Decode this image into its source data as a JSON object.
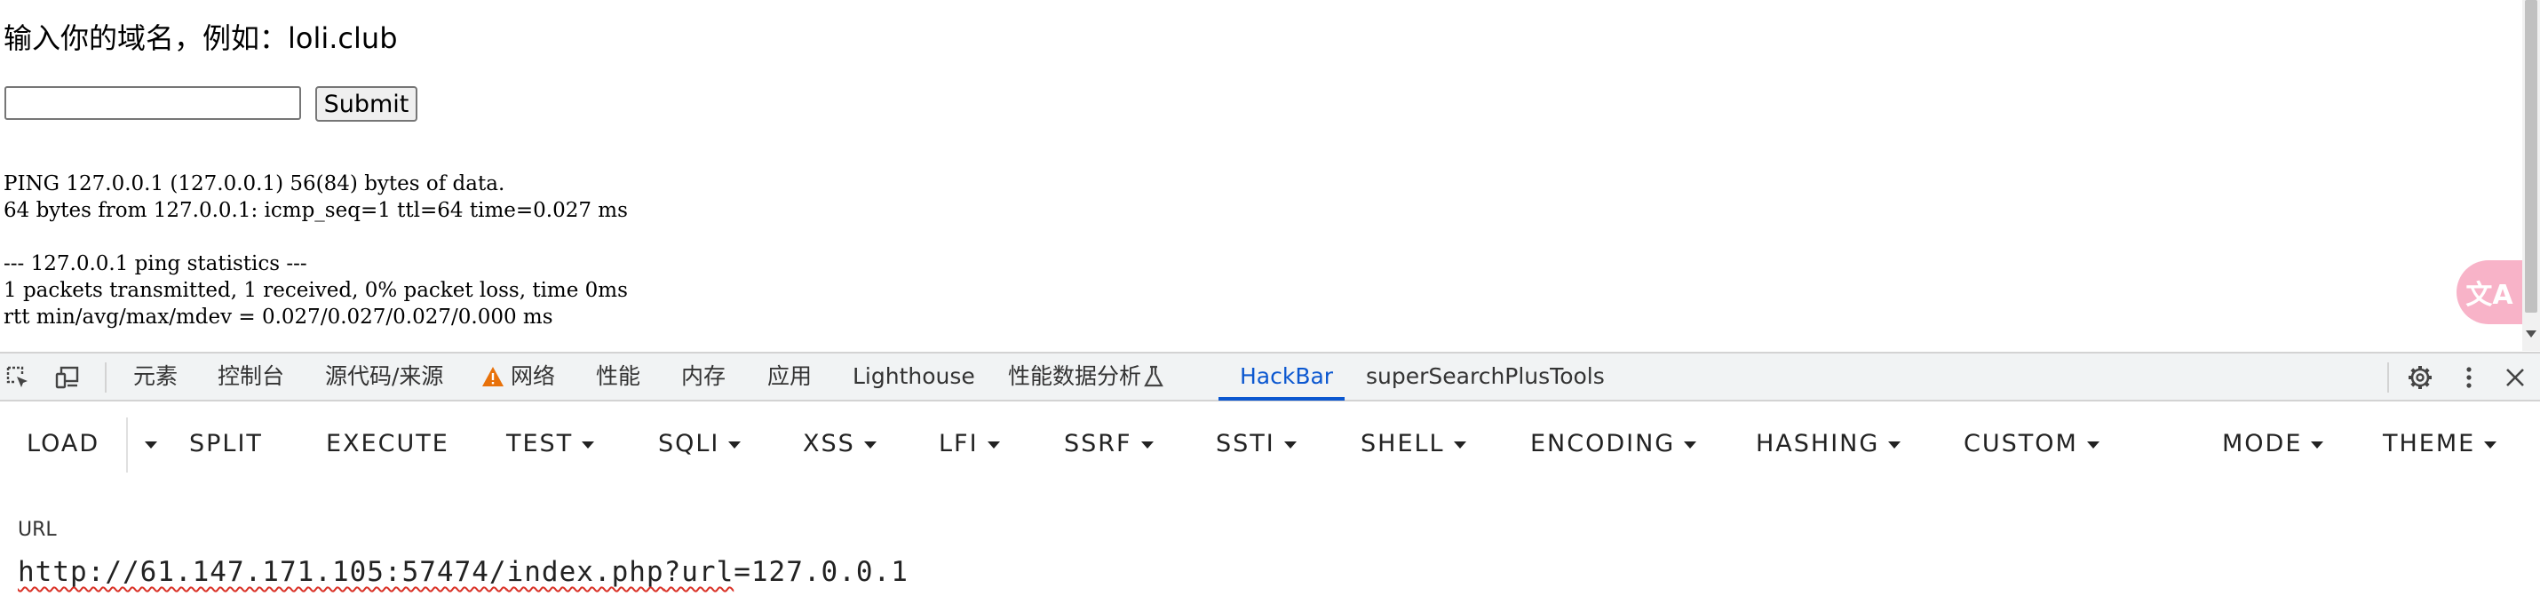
{
  "page": {
    "prompt": "输入你的域名，例如：loli.club",
    "input_value": "",
    "submit_label": "Submit",
    "ping_output": "PING 127.0.0.1 (127.0.0.1) 56(84) bytes of data.\n64 bytes from 127.0.0.1: icmp_seq=1 ttl=64 time=0.027 ms\n\n--- 127.0.0.1 ping statistics ---\n1 packets transmitted, 1 received, 0% packet loss, time 0ms\nrtt min/avg/max/mdev = 0.027/0.027/0.027/0.000 ms"
  },
  "translate_fab": {
    "glyph": "文A",
    "color": "#f8b3c8"
  },
  "devtools": {
    "tabs": [
      {
        "label": "元素"
      },
      {
        "label": "控制台"
      },
      {
        "label": "源代码/来源"
      },
      {
        "label": "网络",
        "warning": true
      },
      {
        "label": "性能"
      },
      {
        "label": "内存"
      },
      {
        "label": "应用"
      },
      {
        "label": "Lighthouse"
      },
      {
        "label": "性能数据分析",
        "flask": true
      },
      {
        "label": "HackBar",
        "active": true
      },
      {
        "label": "superSearchPlusTools"
      }
    ],
    "active_color": "#0b57d0"
  },
  "hackbar": {
    "buttons": [
      "LOAD",
      "SPLIT",
      "EXECUTE",
      "TEST",
      "SQLI",
      "XSS",
      "LFI",
      "SSRF",
      "SSTI",
      "SHELL",
      "ENCODING",
      "HASHING",
      "CUSTOM",
      "MODE",
      "THEME"
    ],
    "url_label": "URL",
    "url_host": "http://61.147.171.105:57474/",
    "url_path": "index.php",
    "url_query_key": "?url",
    "url_query_value": "=127.0.0.1"
  }
}
